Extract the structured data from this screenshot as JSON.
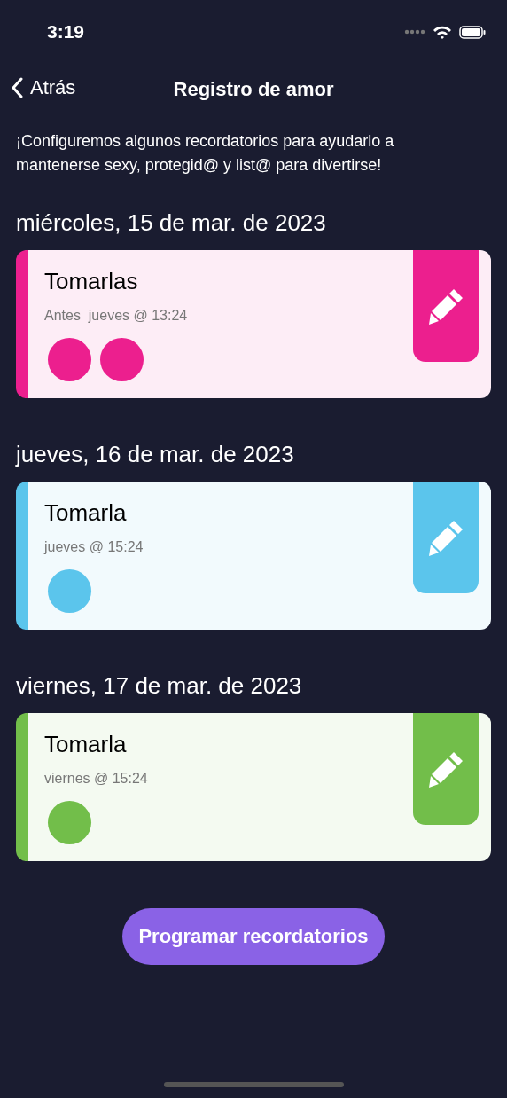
{
  "status_bar": {
    "time": "3:19"
  },
  "nav": {
    "back": "Atrás",
    "title": "Registro de amor"
  },
  "intro": "¡Configuremos algunos recordatorios para ayudarlo a mantenerse sexy, protegid@ y list@ para divertirse!",
  "days": [
    {
      "date": "miércoles, 15 de mar. de 2023",
      "title": "Tomarlas",
      "when": "Antes  jueves @ 13:24",
      "color": "#ec1f8e",
      "dots": [
        {
          "color": "#ec1f8e"
        },
        {
          "color": "#ec1f8e"
        }
      ]
    },
    {
      "date": "jueves, 16 de mar. de 2023",
      "title": "Tomarla",
      "when": "jueves @ 15:24",
      "color": "#5bc5ec",
      "dots": [
        {
          "color": "#5bc5ec"
        }
      ]
    },
    {
      "date": "viernes, 17 de mar. de 2023",
      "title": "Tomarla",
      "when": "viernes @ 15:24",
      "color": "#72be4a",
      "dots": [
        {
          "color": "#72be4a"
        }
      ]
    }
  ],
  "button": "Programar recordatorios"
}
